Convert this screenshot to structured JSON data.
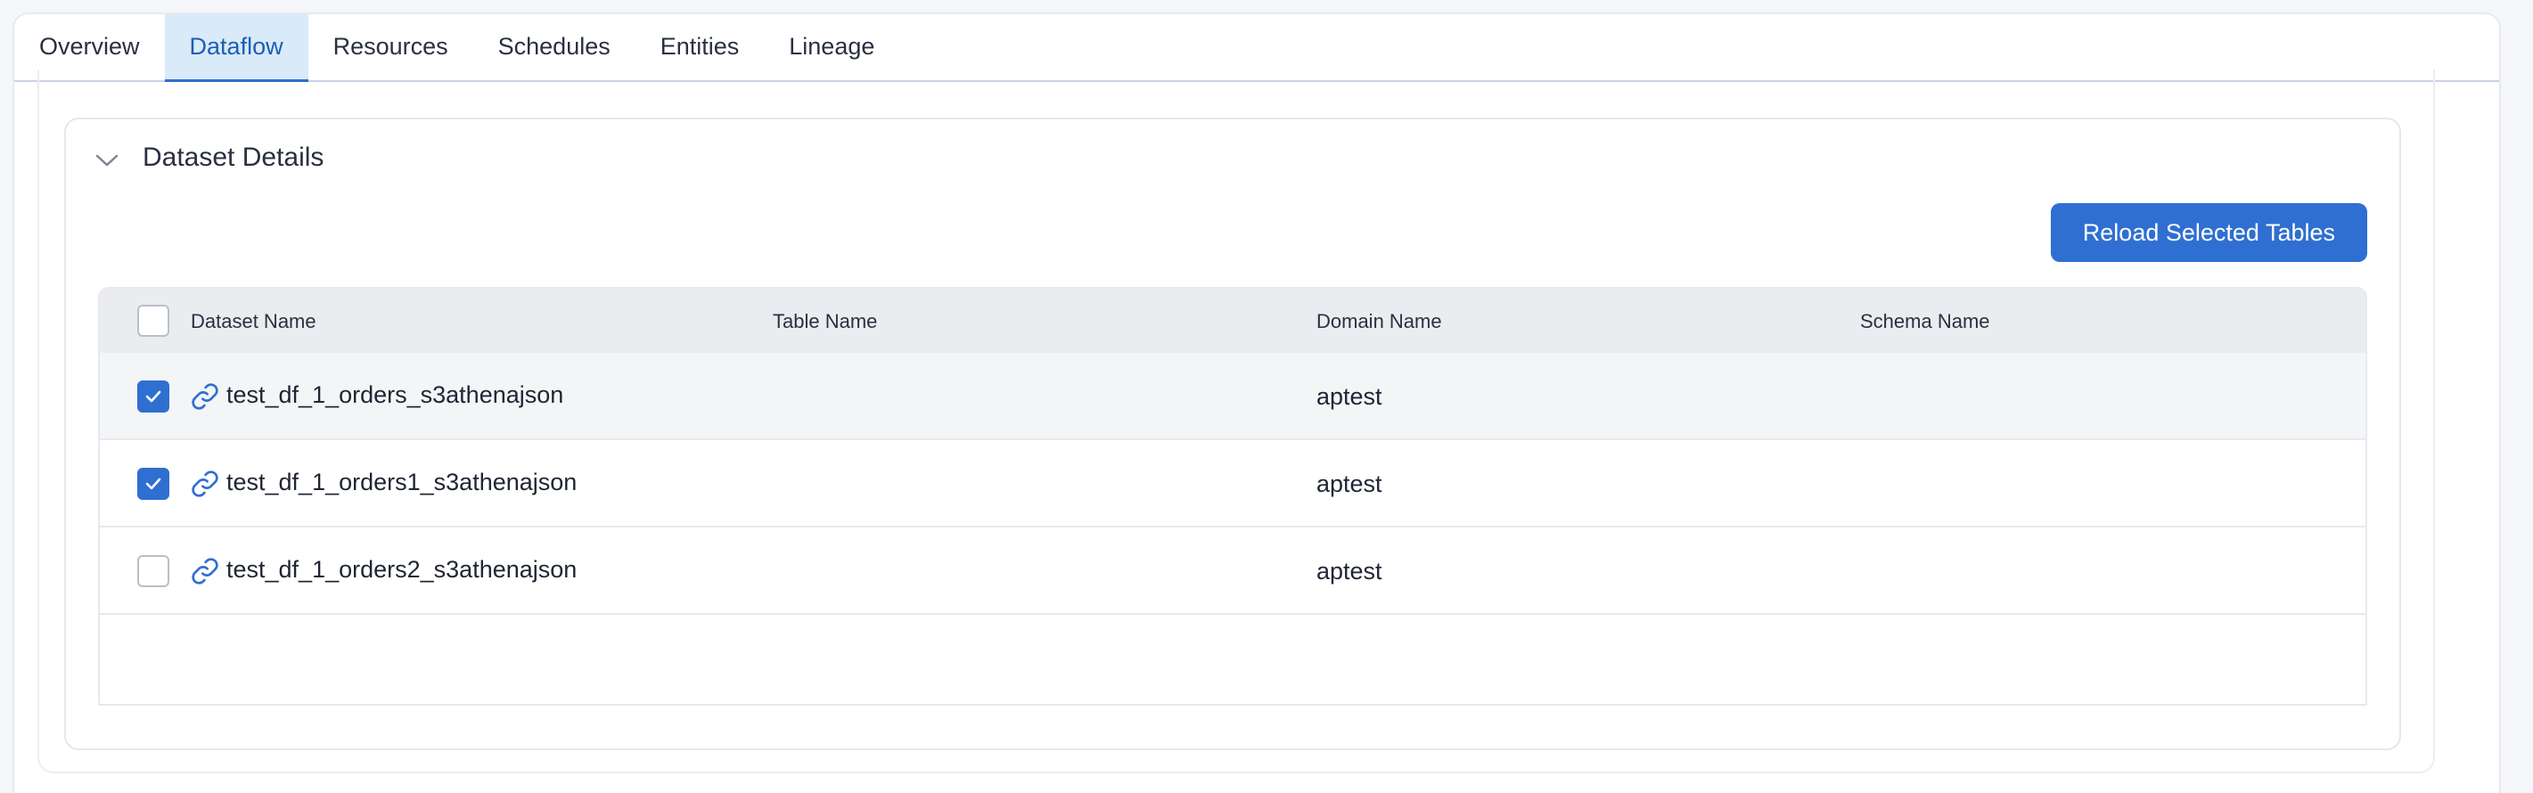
{
  "tabs": [
    {
      "label": "Overview",
      "active": false
    },
    {
      "label": "Dataflow",
      "active": true
    },
    {
      "label": "Resources",
      "active": false
    },
    {
      "label": "Schedules",
      "active": false
    },
    {
      "label": "Entities",
      "active": false
    },
    {
      "label": "Lineage",
      "active": false
    }
  ],
  "panel": {
    "title": "Dataset Details",
    "reload_label": "Reload Selected Tables"
  },
  "table": {
    "headers": {
      "dataset_name": "Dataset Name",
      "table_name": "Table Name",
      "domain_name": "Domain Name",
      "schema_name": "Schema Name"
    },
    "rows": [
      {
        "dataset_name": "test_df_1_orders_s3athenajson",
        "table_name": "",
        "domain_name": "aptest",
        "schema_name": "",
        "checked": true
      },
      {
        "dataset_name": "test_df_1_orders1_s3athenajson",
        "table_name": "",
        "domain_name": "aptest",
        "schema_name": "",
        "checked": true
      },
      {
        "dataset_name": "test_df_1_orders2_s3athenajson",
        "table_name": "",
        "domain_name": "aptest",
        "schema_name": "",
        "checked": false
      }
    ]
  },
  "icons": {
    "collapse": "chevron-down-icon",
    "link": "link-icon",
    "check": "check-icon"
  },
  "colors": {
    "accent": "#2f6fd2",
    "active_tab_bg": "#d9eaf8",
    "header_bg": "#ebecef"
  }
}
